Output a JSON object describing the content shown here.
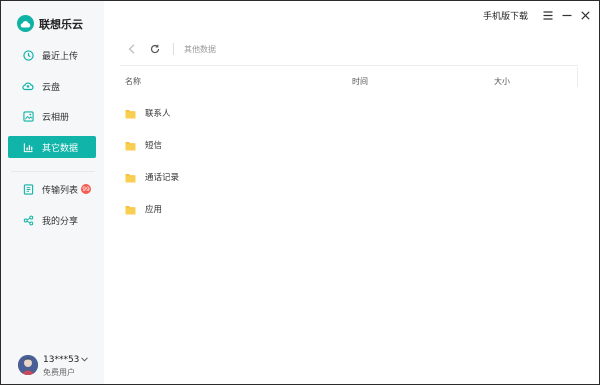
{
  "app": {
    "name": "联想乐云"
  },
  "topbar": {
    "mobile_download": "手机版下载"
  },
  "sidebar": {
    "items": [
      {
        "label": "最近上传",
        "icon": "clock-icon"
      },
      {
        "label": "云盘",
        "icon": "cloud-icon"
      },
      {
        "label": "云相册",
        "icon": "image-icon"
      },
      {
        "label": "其它数据",
        "icon": "chart-icon",
        "active": true
      },
      {
        "label": "传输列表",
        "icon": "transfer-icon",
        "badge": "99"
      },
      {
        "label": "我的分享",
        "icon": "share-icon"
      }
    ]
  },
  "user": {
    "name": "13***53",
    "type": "免费用户"
  },
  "toolbar": {
    "breadcrumb": "其他数据"
  },
  "table": {
    "headers": [
      "名称",
      "时间",
      "大小"
    ],
    "rows": [
      {
        "name": "联系人"
      },
      {
        "name": "短信"
      },
      {
        "name": "通话记录"
      },
      {
        "name": "应用"
      }
    ]
  },
  "colors": {
    "accent": "#10b4a8",
    "folder": "#f5c33b",
    "badge": "#f55b4e"
  }
}
